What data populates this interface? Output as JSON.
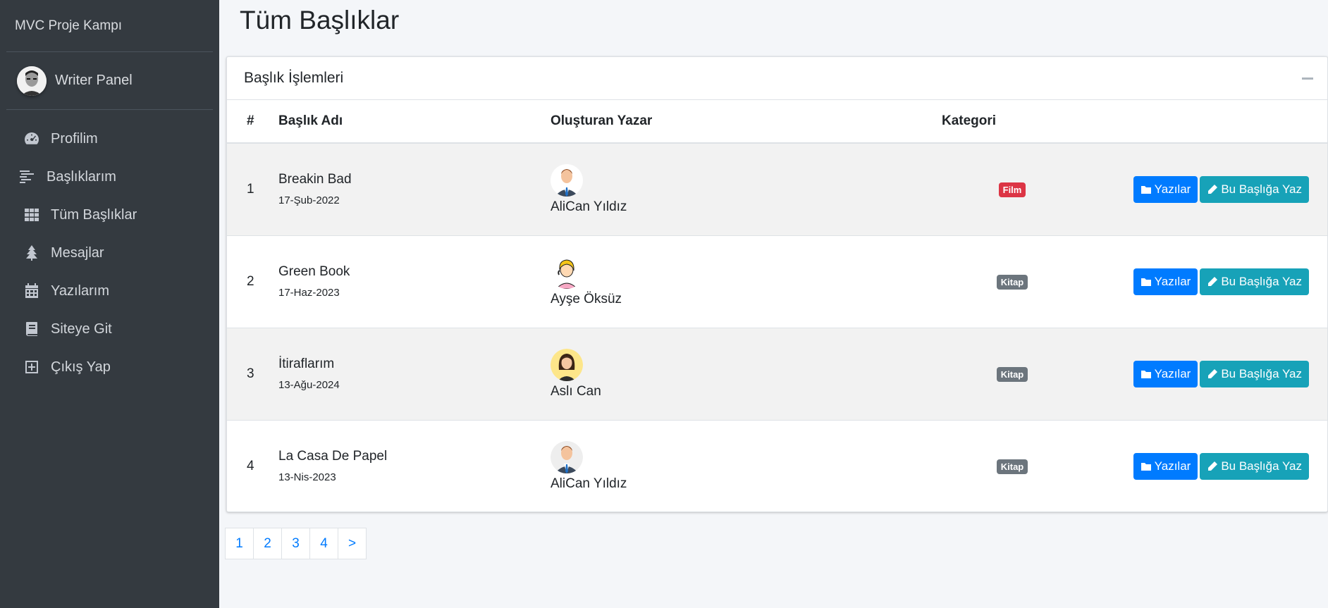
{
  "app": {
    "brand": "MVC Proje Kampı",
    "user_panel": "Writer Panel"
  },
  "sidebar": {
    "items": [
      {
        "label": "Profilim",
        "icon": "dashboard-gauge-icon"
      },
      {
        "label": "Başlıklarım",
        "icon": "stream-lines-icon"
      },
      {
        "label": "Tüm Başlıklar",
        "icon": "grid-icon"
      },
      {
        "label": "Mesajlar",
        "icon": "tree-icon"
      },
      {
        "label": "Yazılarım",
        "icon": "calendar-icon"
      },
      {
        "label": "Siteye Git",
        "icon": "book-icon"
      },
      {
        "label": "Çıkış Yap",
        "icon": "plus-square-icon"
      }
    ]
  },
  "page": {
    "title": "Tüm Başlıklar"
  },
  "card": {
    "header": "Başlık İşlemleri"
  },
  "table": {
    "headers": [
      "#",
      "Başlık Adı",
      "Oluşturan Yazar",
      "Kategori"
    ],
    "rows": [
      {
        "num": "1",
        "title": "Breakin Bad",
        "date": "17-Şub-2022",
        "author": "AliCan Yıldız",
        "avatar": "man-suit",
        "category": "Film",
        "category_color": "#dc3545"
      },
      {
        "num": "2",
        "title": "Green Book",
        "date": "17-Haz-2023",
        "author": "Ayşe Öksüz",
        "avatar": "woman-headset",
        "category": "Kitap",
        "category_color": "#6c757d"
      },
      {
        "num": "3",
        "title": "İtiraflarım",
        "date": "13-Ağu-2024",
        "author": "Aslı Can",
        "avatar": "woman-dark-hair",
        "category": "Kitap",
        "category_color": "#6c757d"
      },
      {
        "num": "4",
        "title": "La Casa De Papel",
        "date": "13-Nis-2023",
        "author": "AliCan Yıldız",
        "avatar": "man-suit",
        "category": "Kitap",
        "category_color": "#6c757d"
      }
    ],
    "btn_posts": "Yazılar",
    "btn_write": "Bu Başlığa Yaz"
  },
  "pagination": [
    "1",
    "2",
    "3",
    "4",
    ">"
  ],
  "colors": {
    "sidebar_bg": "#343a40",
    "primary": "#007bff",
    "info": "#17a2b8",
    "danger": "#dc3545",
    "secondary": "#6c757d"
  }
}
